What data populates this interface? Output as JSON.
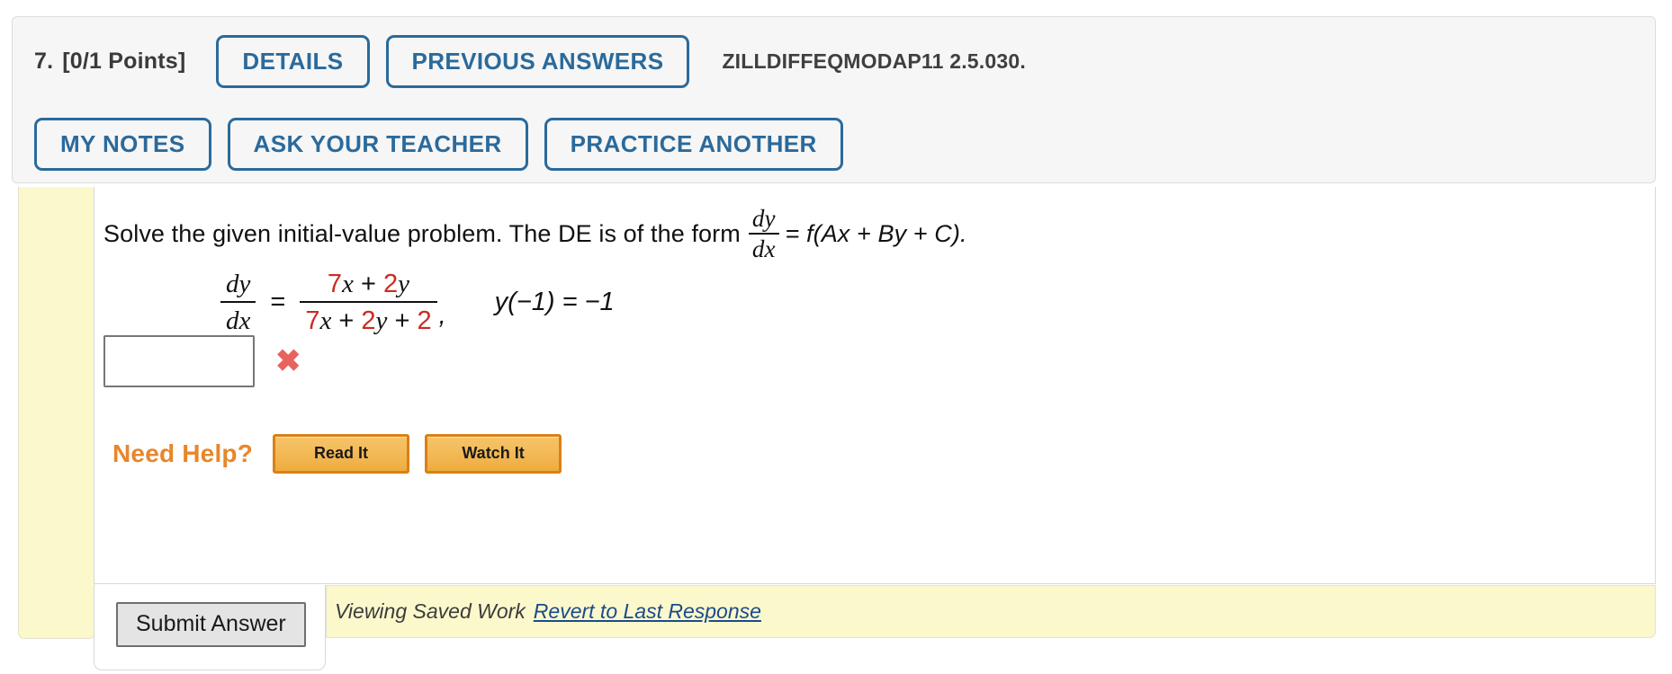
{
  "header": {
    "question_number": "7.",
    "points": "[0/1 Points]",
    "buttons_row1": [
      {
        "label": "DETAILS",
        "name": "details-button"
      },
      {
        "label": "PREVIOUS ANSWERS",
        "name": "previous-answers-button"
      }
    ],
    "assignment_code": "ZILLDIFFEQMODAP11 2.5.030.",
    "buttons_row2": [
      {
        "label": "MY NOTES",
        "name": "my-notes-button"
      },
      {
        "label": "ASK YOUR TEACHER",
        "name": "ask-your-teacher-button"
      },
      {
        "label": "PRACTICE ANOTHER",
        "name": "practice-another-button"
      }
    ]
  },
  "problem": {
    "prompt_before": "Solve the given initial-value problem. The DE is of the form",
    "prompt_frac_num": "dy",
    "prompt_frac_den": "dx",
    "prompt_after": "= f(Ax + By + C).",
    "equation": {
      "lhs_num": "dy",
      "lhs_den": "dx",
      "equals": "=",
      "rhs_num_coef_x": "7",
      "rhs_num_var_x": "x",
      "rhs_num_plus": "+",
      "rhs_num_coef_y": "2",
      "rhs_num_var_y": "y",
      "rhs_den_coef_x": "7",
      "rhs_den_var_x": "x",
      "rhs_den_plus1": "+",
      "rhs_den_coef_y": "2",
      "rhs_den_var_y": "y",
      "rhs_den_plus2": "+",
      "rhs_den_const": "2",
      "comma": ",",
      "initial_condition": "y(−1) = −1",
      "red_color": "#cc2b20"
    }
  },
  "answer": {
    "value": "",
    "placeholder": "",
    "grade_mark": "✖",
    "grade_mark_name": "incorrect-x-icon",
    "grade_mark_color": "#e8635c"
  },
  "help": {
    "label": "Need Help?",
    "label_color": "#e8862b",
    "buttons": [
      {
        "label": "Read It",
        "name": "read-it-button"
      },
      {
        "label": "Watch It",
        "name": "watch-it-button"
      }
    ]
  },
  "footer": {
    "submit_label": "Submit Answer",
    "saved_work_text": "Viewing Saved Work",
    "revert_link": "Revert to Last Response",
    "bar_color": "#fbf8cc"
  },
  "theme": {
    "accent_blue": "#2b6a9b",
    "orange": "#e8862b",
    "panel_gray": "#f6f6f6"
  }
}
